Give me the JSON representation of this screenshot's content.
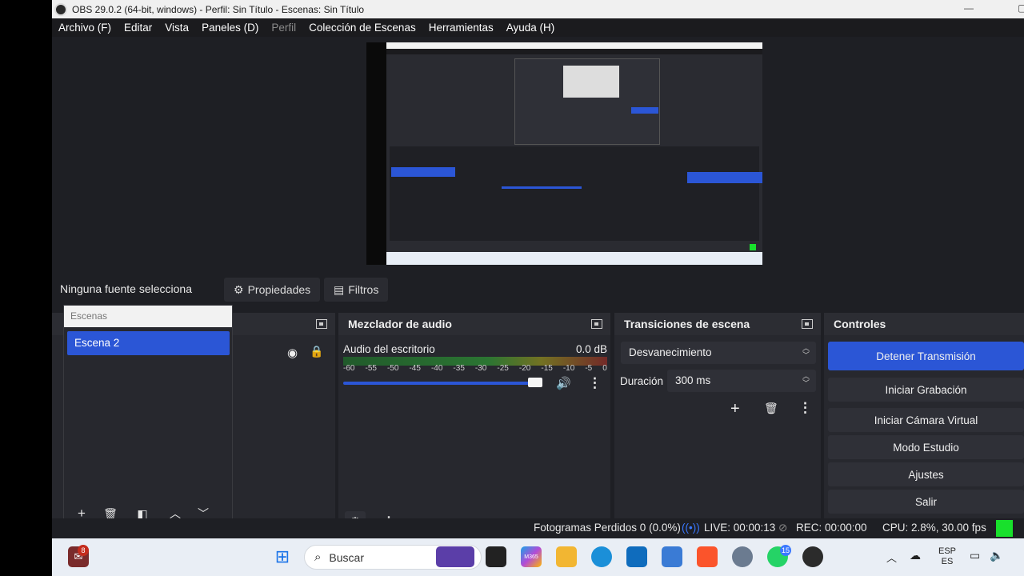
{
  "window": {
    "title": "OBS 29.0.2 (64-bit, windows) - Perfil: Sin Título - Escenas: Sin Título"
  },
  "menu": {
    "items": [
      "Archivo (F)",
      "Editar",
      "Vista",
      "Paneles (D)",
      "Perfil",
      "Colección de Escenas",
      "Herramientas",
      "Ayuda (H)"
    ]
  },
  "source_bar": {
    "no_source": "Ninguna fuente selecciona",
    "properties": "Propiedades",
    "filters": "Filtros"
  },
  "scenes": {
    "header": "Escenas",
    "items": [
      "Escena 2"
    ]
  },
  "audio_mixer": {
    "title": "Mezclador de audio",
    "channel_name": "Audio del escritorio",
    "level": "0.0 dB",
    "scale": [
      "-60",
      "-55",
      "-50",
      "-45",
      "-40",
      "-35",
      "-30",
      "-25",
      "-20",
      "-15",
      "-10",
      "-5",
      "0"
    ],
    "volume_fraction": 0.95
  },
  "transitions": {
    "title": "Transiciones de escena",
    "selected": "Desvanecimiento",
    "duration_label": "Duración",
    "duration_value": "300 ms"
  },
  "controls": {
    "title": "Controles",
    "buttons": [
      "Detener Transmisión",
      "Iniciar Grabación",
      "Iniciar Cámara Virtual",
      "Modo Estudio",
      "Ajustes",
      "Salir"
    ]
  },
  "status": {
    "dropped": "Fotogramas Perdidos 0 (0.0%)",
    "live": "LIVE: 00:00:13",
    "rec": "REC: 00:00:00",
    "cpu": "CPU: 2.8%, 30.00 fps",
    "indicator_color": "#18e02c"
  },
  "taskbar": {
    "search_placeholder": "Buscar",
    "badge_notifications": "8",
    "badge_whatsapp": "15",
    "lang_top": "ESP",
    "lang_bottom": "ES",
    "m365_label": "M365"
  },
  "colors": {
    "accent": "#2b56d6",
    "panel": "#27282e",
    "background": "#1e1f24"
  }
}
